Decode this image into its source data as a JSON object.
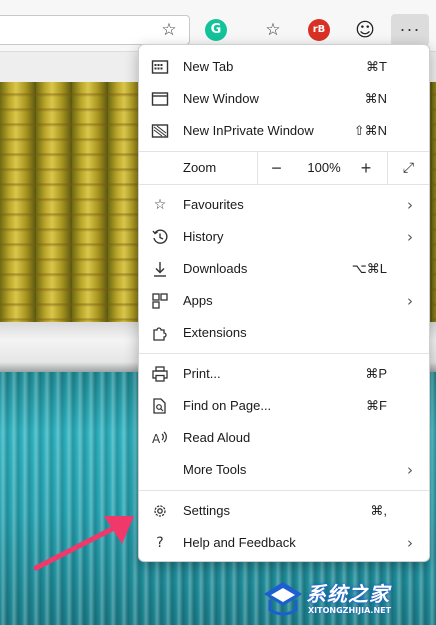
{
  "toolbar": {
    "favorite_icon": "star-outline",
    "grammarly_letter": "G",
    "rb_label": "rB",
    "more_label": "···"
  },
  "menu": {
    "new_tab": {
      "label": "New Tab",
      "shortcut": "⌘T"
    },
    "new_window": {
      "label": "New Window",
      "shortcut": "⌘N"
    },
    "new_inprivate": {
      "label": "New InPrivate Window",
      "shortcut": "⇧⌘N"
    },
    "zoom": {
      "label": "Zoom",
      "minus": "−",
      "value": "100%",
      "plus": "+"
    },
    "favourites": {
      "label": "Favourites"
    },
    "history": {
      "label": "History"
    },
    "downloads": {
      "label": "Downloads",
      "shortcut": "⌥⌘L"
    },
    "apps": {
      "label": "Apps"
    },
    "extensions": {
      "label": "Extensions"
    },
    "print": {
      "label": "Print...",
      "shortcut": "⌘P"
    },
    "find": {
      "label": "Find on Page...",
      "shortcut": "⌘F"
    },
    "read_aloud": {
      "label": "Read Aloud"
    },
    "more_tools": {
      "label": "More Tools"
    },
    "settings": {
      "label": "Settings",
      "shortcut": "⌘,"
    },
    "help": {
      "label": "Help and Feedback"
    }
  },
  "watermark": {
    "title": "系统之家",
    "url": "XITONGZHIJIA.NET"
  },
  "colors": {
    "arrow": "#f0386b",
    "grammarly": "#15c39a",
    "rb": "#d93025"
  }
}
